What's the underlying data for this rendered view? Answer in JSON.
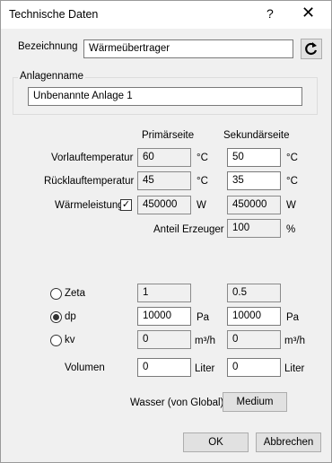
{
  "window": {
    "title": "Technische Daten",
    "help": "?",
    "close": "✕"
  },
  "bezeichnung": {
    "label": "Bezeichnung",
    "value": "Wärmeübertrager"
  },
  "anlagenname": {
    "label": "Anlagenname",
    "value": "Unbenannte Anlage 1"
  },
  "columns": {
    "primary": "Primärseite",
    "secondary": "Sekundärseite"
  },
  "rows": {
    "vorlauf": {
      "label": "Vorlauftemperatur",
      "primary": "60",
      "primary_unit": "°C",
      "secondary": "50",
      "secondary_unit": "°C"
    },
    "ruecklauf": {
      "label": "Rücklauftemperatur",
      "primary": "45",
      "primary_unit": "°C",
      "secondary": "35",
      "secondary_unit": "°C"
    },
    "leistung": {
      "label": "Wärmeleistung",
      "checked": true,
      "check_mark": "✓",
      "primary": "450000",
      "primary_unit": "W",
      "secondary": "450000",
      "secondary_unit": "W"
    },
    "anteil": {
      "label": "Anteil Erzeuger",
      "value": "100",
      "unit": "%"
    }
  },
  "options": {
    "zeta": {
      "label": "Zeta",
      "selected": false,
      "primary": "1",
      "primary_unit": "",
      "secondary": "0.5",
      "secondary_unit": ""
    },
    "dp": {
      "label": "dp",
      "selected": true,
      "primary": "10000",
      "primary_unit": "Pa",
      "secondary": "10000",
      "secondary_unit": "Pa"
    },
    "kv": {
      "label": "kv",
      "selected": false,
      "primary": "0",
      "primary_unit": "m³/h",
      "secondary": "0",
      "secondary_unit": "m³/h"
    }
  },
  "volumen": {
    "label": "Volumen",
    "primary": "0",
    "primary_unit": "Liter",
    "secondary": "0",
    "secondary_unit": "Liter"
  },
  "medium": {
    "label": "Wasser (von Global)",
    "button": "Medium"
  },
  "buttons": {
    "ok": "OK",
    "cancel": "Abbrechen"
  }
}
